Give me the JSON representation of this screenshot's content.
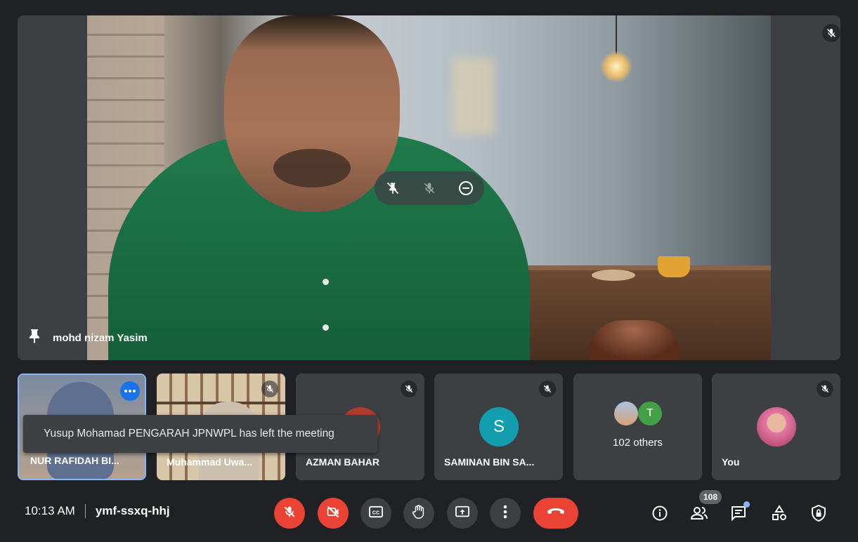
{
  "main_speaker": {
    "name": "mohd nizam Yasim",
    "pinned": true,
    "muted": true
  },
  "participants": [
    {
      "name": "NUR RAFIDAH BI...",
      "muted": false,
      "has_video": true,
      "active": true,
      "menu_icon": "more-horiz-icon"
    },
    {
      "name": "Muhammad Uwa...",
      "muted": true,
      "has_video": true
    },
    {
      "name": "AZMAN BAHAR",
      "muted": true,
      "has_video": false
    },
    {
      "name": "SAMINAN BIN SA...",
      "muted": true,
      "has_video": false,
      "avatar_letter": "S",
      "avatar_color": "#129eaf"
    },
    {
      "name": "102 others",
      "avatar_letter": "T",
      "avatar_color": "#43a047"
    },
    {
      "name": "You",
      "muted": true,
      "has_video": false
    }
  ],
  "toast": {
    "message": "Yusup Mohamad PENGARAH JPNWPL has left the meeting"
  },
  "meeting": {
    "time": "10:13 AM",
    "code": "ymf-ssxq-hhj"
  },
  "controls": [
    {
      "name": "microphone-toggle",
      "icon": "mic-off-icon",
      "state": "off",
      "color": "#ea4335"
    },
    {
      "name": "camera-toggle",
      "icon": "videocam-off-icon",
      "state": "off",
      "color": "#ea4335"
    },
    {
      "name": "captions-button",
      "icon": "closed-caption-icon"
    },
    {
      "name": "raise-hand-button",
      "icon": "hand-icon"
    },
    {
      "name": "present-button",
      "icon": "present-screen-icon"
    },
    {
      "name": "more-options-button",
      "icon": "more-vert-icon"
    },
    {
      "name": "leave-call-button",
      "icon": "call-end-icon",
      "color": "#ea4335"
    }
  ],
  "side_controls": {
    "people_count": "108",
    "icons": [
      "info-icon",
      "people-icon",
      "chat-icon",
      "activities-icon",
      "host-controls-icon"
    ]
  },
  "colors": {
    "background": "#202124",
    "tile": "#3c4043",
    "danger": "#ea4335",
    "accent": "#8ab4f8"
  }
}
